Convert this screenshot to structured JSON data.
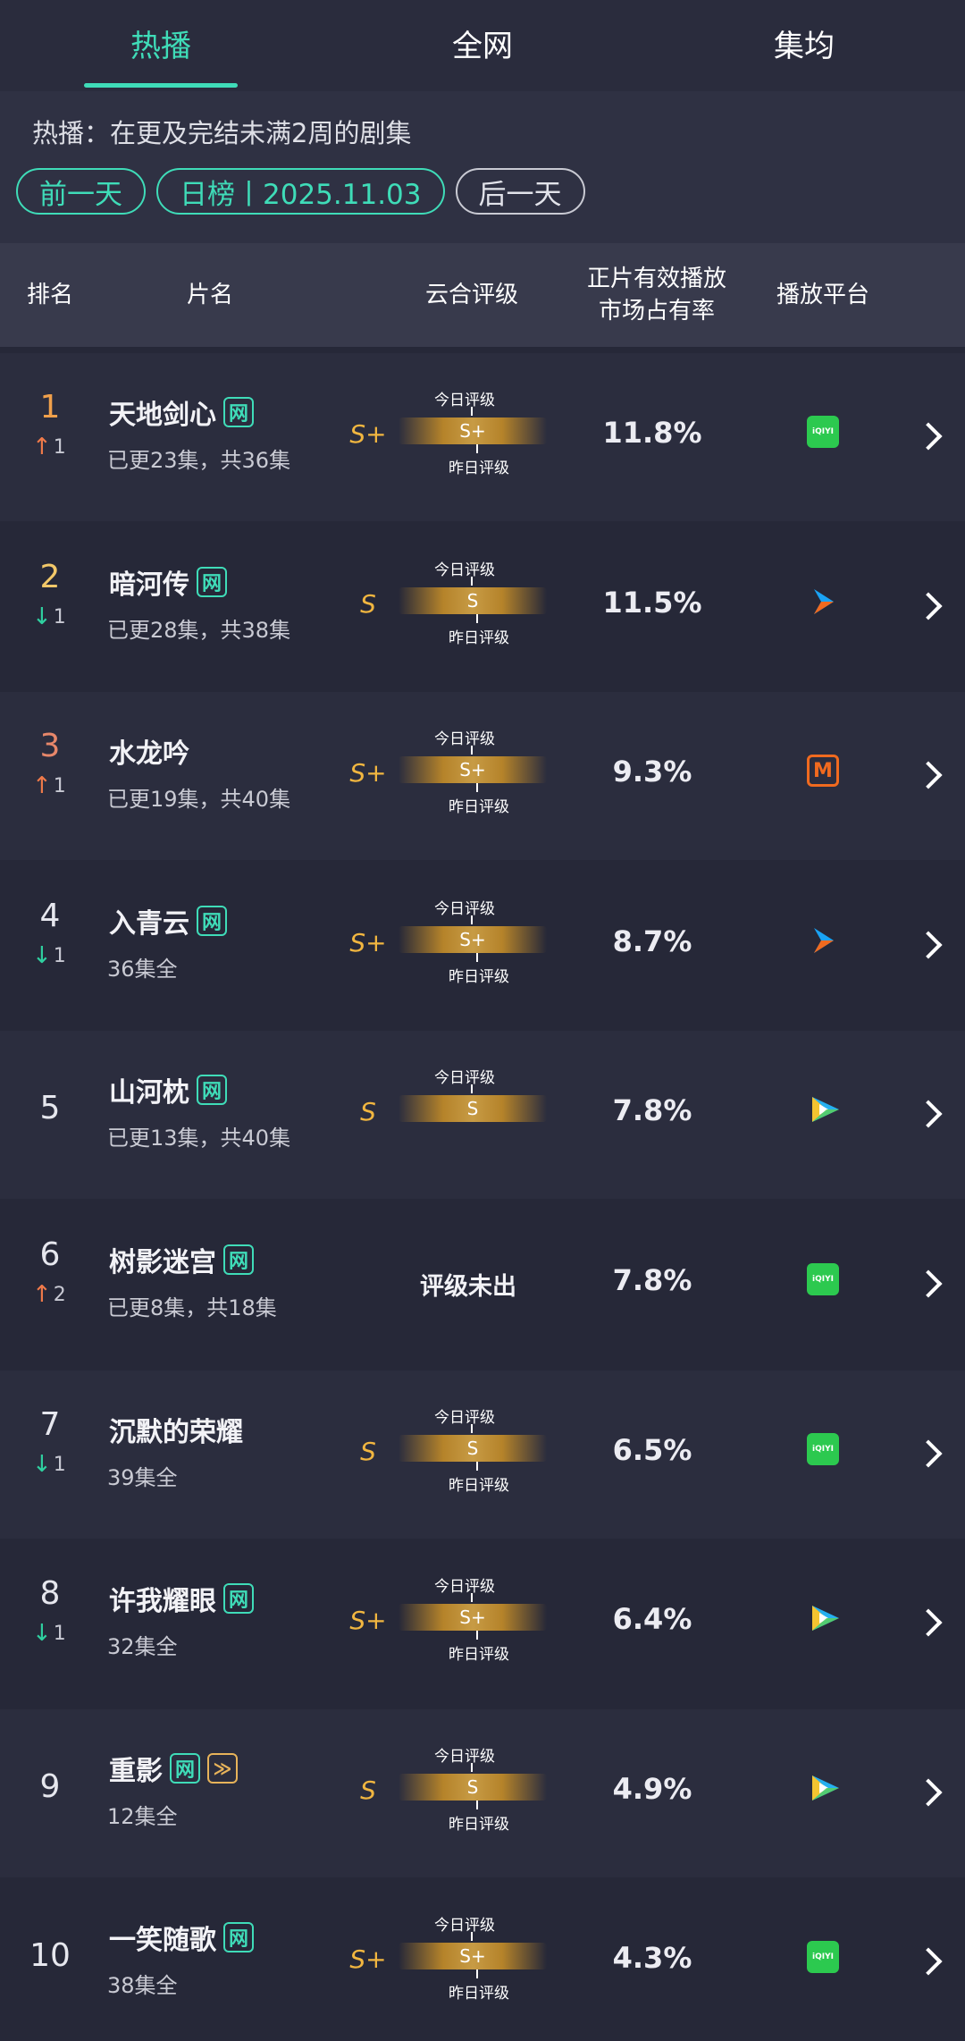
{
  "tabs": [
    {
      "label": "热播",
      "active": true
    },
    {
      "label": "全网",
      "active": false
    },
    {
      "label": "集均",
      "active": false
    }
  ],
  "description": "热播：在更及完结未满2周的剧集",
  "date_controls": {
    "prev": "前一天",
    "current": "日榜丨2025.11.03",
    "next": "后一天"
  },
  "table_headers": {
    "rank": "排名",
    "title": "片名",
    "grade": "云合评级",
    "share_line1": "正片有效播放",
    "share_line2": "市场占有率",
    "platform": "播放平台"
  },
  "rating_labels": {
    "today": "今日评级",
    "yesterday": "昨日评级",
    "none": "评级未出"
  },
  "colors": {
    "accent": "#3fdcb8",
    "up": "#f07a4a",
    "down": "#2fd0a0",
    "grade": "#f1b640"
  },
  "rows": [
    {
      "rank": "1",
      "change_dir": "up",
      "change": "1",
      "title": "天地剑心",
      "tags": [
        "网"
      ],
      "episodes": "已更23集，共36集",
      "grade": "S+",
      "bar_text": "S+",
      "share": "11.8%",
      "platform": "iqiyi-icon"
    },
    {
      "rank": "2",
      "change_dir": "down",
      "change": "1",
      "title": "暗河传",
      "tags": [
        "网"
      ],
      "episodes": "已更28集，共38集",
      "grade": "S",
      "bar_text": "S",
      "share": "11.5%",
      "platform": "youku-icon"
    },
    {
      "rank": "3",
      "change_dir": "up",
      "change": "1",
      "title": "水龙吟",
      "tags": [],
      "episodes": "已更19集，共40集",
      "grade": "S+",
      "bar_text": "S+",
      "share": "9.3%",
      "platform": "mgtv-icon"
    },
    {
      "rank": "4",
      "change_dir": "down",
      "change": "1",
      "title": "入青云",
      "tags": [
        "网"
      ],
      "episodes": "36集全",
      "grade": "S+",
      "bar_text": "S+",
      "share": "8.7%",
      "platform": "youku-icon"
    },
    {
      "rank": "5",
      "change_dir": "",
      "change": "",
      "title": "山河枕",
      "tags": [
        "网"
      ],
      "episodes": "已更13集，共40集",
      "grade": "S",
      "bar_text": "S",
      "share": "7.8%",
      "platform": "tencent-video-icon",
      "no_yesterday": true
    },
    {
      "rank": "6",
      "change_dir": "up",
      "change": "2",
      "title": "树影迷宫",
      "tags": [
        "网"
      ],
      "episodes": "已更8集，共18集",
      "grade": "",
      "bar_text": "",
      "share": "7.8%",
      "platform": "iqiyi-icon",
      "no_grade": true
    },
    {
      "rank": "7",
      "change_dir": "down",
      "change": "1",
      "title": "沉默的荣耀",
      "tags": [],
      "episodes": "39集全",
      "grade": "S",
      "bar_text": "S",
      "share": "6.5%",
      "platform": "iqiyi-icon"
    },
    {
      "rank": "8",
      "change_dir": "down",
      "change": "1",
      "title": "许我耀眼",
      "tags": [
        "网"
      ],
      "episodes": "32集全",
      "grade": "S+",
      "bar_text": "S+",
      "share": "6.4%",
      "platform": "tencent-video-icon"
    },
    {
      "rank": "9",
      "change_dir": "",
      "change": "",
      "title": "重影",
      "tags": [
        "网",
        "≫"
      ],
      "episodes": "12集全",
      "grade": "S",
      "bar_text": "S",
      "share": "4.9%",
      "platform": "tencent-video-icon"
    },
    {
      "rank": "10",
      "change_dir": "",
      "change": "",
      "title": "一笑随歌",
      "tags": [
        "网"
      ],
      "episodes": "38集全",
      "grade": "S+",
      "bar_text": "S+",
      "share": "4.3%",
      "platform": "iqiyi-icon"
    }
  ]
}
